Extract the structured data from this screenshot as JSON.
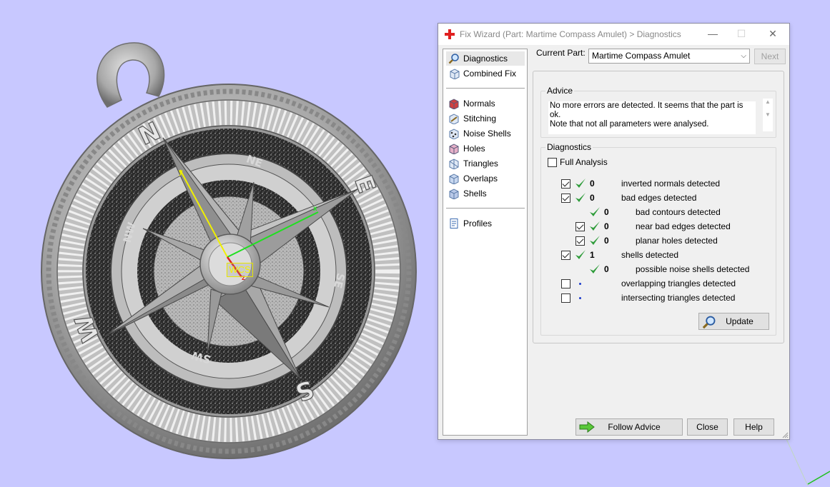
{
  "viewport": {
    "background": "#c8c8ff",
    "wcs_label": "WCS",
    "axis_y_label": "y",
    "axis_x_label": "x",
    "axis_z_label": "z",
    "compass_letters": {
      "north": "N",
      "east": "E",
      "south": "S",
      "west": "W",
      "ne": "NE",
      "se": "SE",
      "sw": "SW",
      "nw": "NW"
    }
  },
  "dialog": {
    "title": "Fix Wizard (Part: Martime Compass Amulet) > Diagnostics",
    "window_buttons": {
      "minimize": "—",
      "maximize": "☐",
      "close": "✕"
    },
    "nav": {
      "items": [
        {
          "label": "Diagnostics",
          "icon": "magnifier-icon",
          "selected": true
        },
        {
          "label": "Combined Fix",
          "icon": "combined-fix-icon"
        },
        {
          "label": "Normals",
          "icon": "normals-icon"
        },
        {
          "label": "Stitching",
          "icon": "stitching-icon"
        },
        {
          "label": "Noise Shells",
          "icon": "noise-shells-icon"
        },
        {
          "label": "Holes",
          "icon": "holes-icon"
        },
        {
          "label": "Triangles",
          "icon": "triangles-icon"
        },
        {
          "label": "Overlaps",
          "icon": "overlaps-icon"
        },
        {
          "label": "Shells",
          "icon": "shells-icon"
        },
        {
          "label": "Profiles",
          "icon": "profiles-icon"
        }
      ]
    },
    "current_part_label": "Current Part:",
    "current_part_value": "Martime Compass Amulet",
    "next_button": "Next",
    "advice": {
      "title": "Advice",
      "line1": "No more errors are detected. It seems that the part is ok.",
      "line2": "Note that not all parameters were analysed."
    },
    "diagnostics": {
      "title": "Diagnostics",
      "full_analysis": "Full Analysis",
      "rows": [
        {
          "label": "inverted normals detected",
          "count": "0",
          "checked": true,
          "ok": true
        },
        {
          "label": "bad edges detected",
          "count": "0",
          "checked": true,
          "ok": true
        },
        {
          "label": "bad contours detected",
          "count": "0",
          "checked": null,
          "ok": true
        },
        {
          "label": "near bad edges detected",
          "count": "0",
          "checked": true,
          "ok": true
        },
        {
          "label": "planar holes detected",
          "count": "0",
          "checked": true,
          "ok": true
        },
        {
          "label": "shells detected",
          "count": "1",
          "checked": true,
          "ok": true
        },
        {
          "label": "possible noise shells detected",
          "count": "0",
          "checked": null,
          "ok": true
        },
        {
          "label": "overlapping triangles detected",
          "count": "",
          "checked": false,
          "ok": false
        },
        {
          "label": "intersecting triangles detected",
          "count": "",
          "checked": false,
          "ok": false
        }
      ],
      "update_button": "Update"
    },
    "footer": {
      "follow_advice": "Follow Advice",
      "close": "Close",
      "help": "Help"
    },
    "colors": {
      "check_green": "#2e9c3a",
      "title_red": "#e02020"
    }
  }
}
